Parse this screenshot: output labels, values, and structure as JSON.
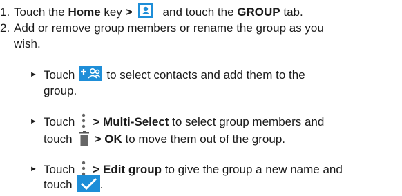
{
  "step1": {
    "num": "1.",
    "pre": "Touch the ",
    "home": "Home",
    "mid": " key ",
    "gt": ">",
    "after_icon": "and touch the ",
    "group_tab": "GROUP",
    "end": " tab.",
    "icon": "contacts-icon"
  },
  "step2": {
    "num": "2.",
    "line1": "Add or remove group members or rename the group as you",
    "line2": "wish."
  },
  "bullet_symbol": "►",
  "bullet1": {
    "pre": "Touch",
    "post": "to select contacts and add them to the",
    "line2": "group.",
    "icon": "add-group-member-icon"
  },
  "bullet2": {
    "pre": "Touch",
    "gt": ">",
    "action": "Multi-Select",
    "post": " to select group members and",
    "touch": "touch",
    "gt2": ">",
    "ok": "OK",
    "post2": " to move them out of the group.",
    "menu_icon": "more-menu-icon",
    "trash_icon": "trash-icon"
  },
  "bullet3": {
    "pre": "Touch",
    "gt": ">",
    "action": "Edit group",
    "post": " to give the group a new name and",
    "touch": "touch",
    "end": ".",
    "menu_icon": "more-menu-icon",
    "check_icon": "check-icon"
  },
  "colors": {
    "icon_blue": "#1e8ed8",
    "text": "#1a1a1a",
    "icon_grey": "#666666"
  }
}
